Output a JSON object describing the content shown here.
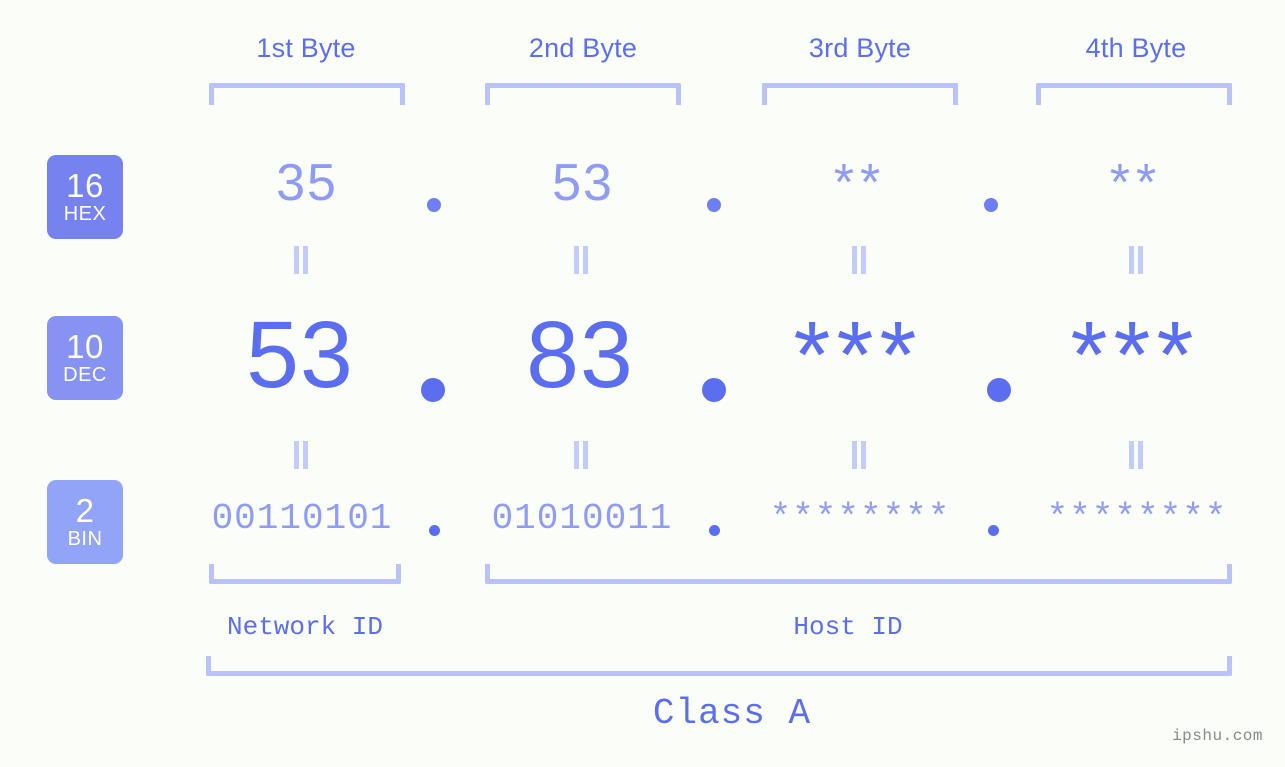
{
  "meta": {
    "watermark": "ipshu.com",
    "background": "#fbfdf8",
    "accent_strong": "#5b6ef0",
    "accent_mid": "#8f9cf5",
    "accent_light": "#b9c2fb"
  },
  "byte_headers": [
    {
      "label": "1st Byte"
    },
    {
      "label": "2nd Byte"
    },
    {
      "label": "3rd Byte"
    },
    {
      "label": "4th Byte"
    }
  ],
  "bases": [
    {
      "id": "hex",
      "number": "16",
      "name": "HEX",
      "color": "#7682ee"
    },
    {
      "id": "dec",
      "number": "10",
      "name": "DEC",
      "color": "#8793f2"
    },
    {
      "id": "bin",
      "number": "2",
      "name": "BIN",
      "color": "#92a4f7"
    }
  ],
  "rows": {
    "hex": {
      "values": [
        "35",
        "53",
        "**",
        "**"
      ],
      "separator": "."
    },
    "dec": {
      "values": [
        "53",
        "83",
        "***",
        "***"
      ],
      "separator": "."
    },
    "bin": {
      "values": [
        "00110101",
        "01010011",
        "********",
        "********"
      ],
      "separator": "."
    }
  },
  "equals_symbol": "=",
  "id_sections": [
    {
      "label": "Network ID"
    },
    {
      "label": "Host ID"
    }
  ],
  "class_section": {
    "label": "Class A"
  }
}
